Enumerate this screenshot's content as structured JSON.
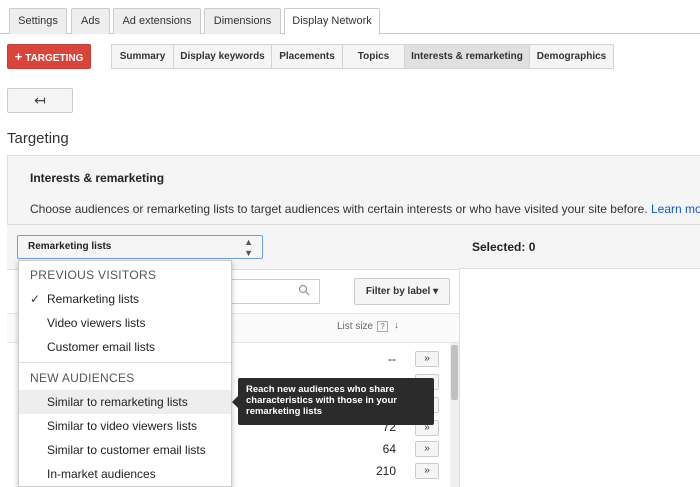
{
  "top_tabs": [
    "Settings",
    "Ads",
    "Ad extensions",
    "Dimensions",
    "Display Network"
  ],
  "targeting_button": {
    "plus": "+",
    "label": "TARGETING"
  },
  "sub_tabs": [
    "Summary",
    "Display keywords",
    "Placements",
    "Topics",
    "Interests & remarketing",
    "Demographics"
  ],
  "back_icon": "↤",
  "page_title": "Targeting",
  "panel": {
    "heading": "Interests & remarketing",
    "description": "Choose audiences or remarketing lists to target audiences with certain interests or who have visited your site before.",
    "learn_more": "Learn more"
  },
  "select": {
    "value": "Remarketing lists"
  },
  "selected": "Selected: 0",
  "filter_label": "Filter by label",
  "list_size_header": "List size",
  "help": "?",
  "dropdown": {
    "previous_heading": "PREVIOUS VISITORS",
    "previous_items": [
      "Remarketing lists",
      "Video viewers lists",
      "Customer email lists"
    ],
    "new_heading": "NEW AUDIENCES",
    "new_items": [
      "Similar to remarketing lists",
      "Similar to video viewers lists",
      "Similar to customer email lists",
      "In-market audiences"
    ]
  },
  "tooltip": "Reach new audiences who share characteristics with those in your remarketing lists",
  "rows": [
    {
      "size": "--"
    },
    {
      "size": "72"
    },
    {
      "size": "64"
    },
    {
      "size": "210"
    }
  ],
  "add_label": "»",
  "colors": {
    "primary_red": "#d9453b",
    "link": "#1155cc",
    "tooltip_bg": "#2b2b2b"
  }
}
